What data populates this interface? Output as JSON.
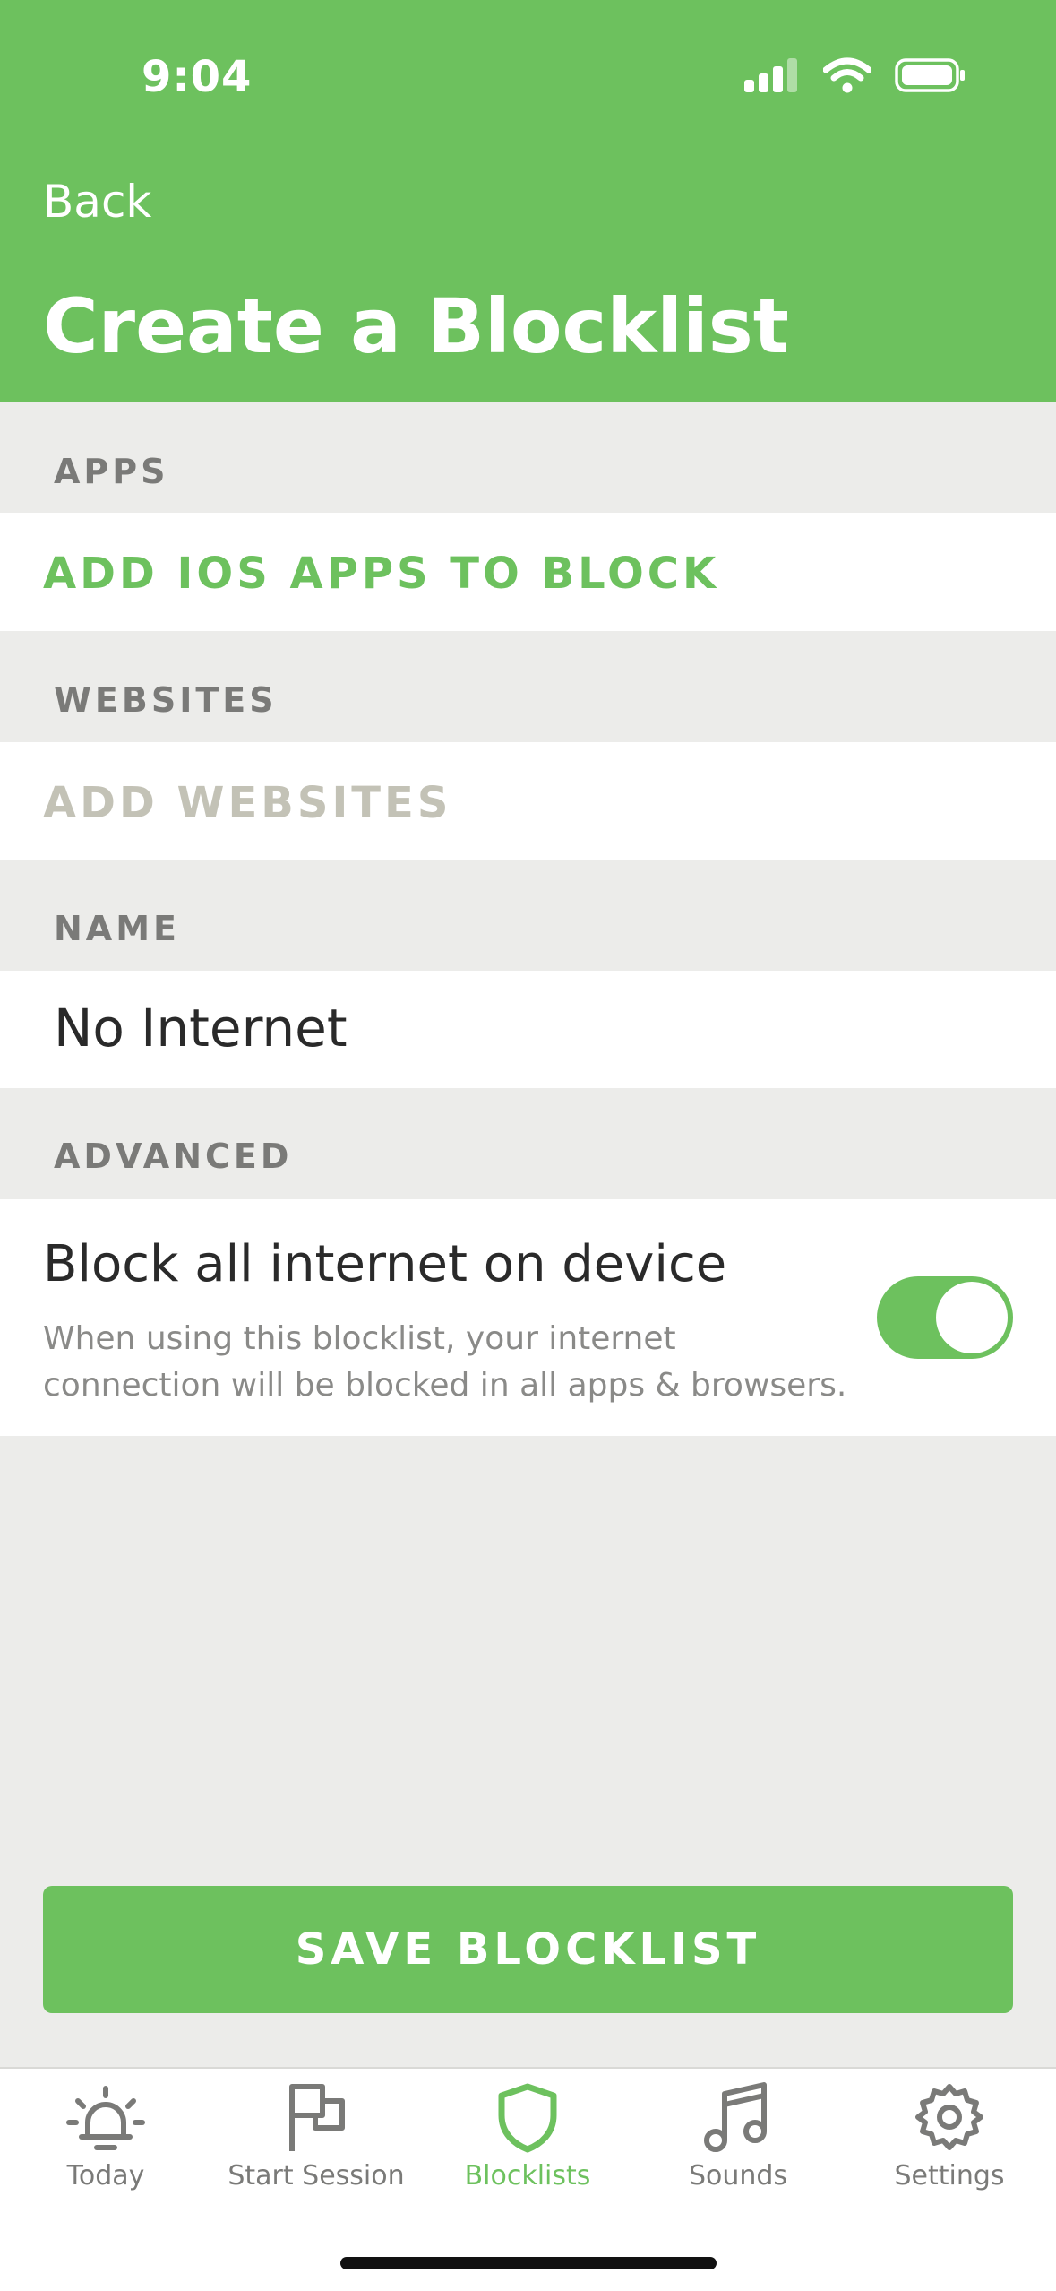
{
  "status_bar": {
    "time": "9:04"
  },
  "header": {
    "back_label": "Back",
    "title": "Create a Blocklist"
  },
  "sections": {
    "apps": {
      "label": "APPS",
      "action": "ADD IOS APPS TO BLOCK"
    },
    "websites": {
      "label": "WEBSITES",
      "action": "ADD WEBSITES"
    },
    "name": {
      "label": "NAME",
      "value": "No Internet"
    },
    "advanced": {
      "label": "ADVANCED",
      "option_title": "Block all internet on device",
      "option_desc_line1": "When using this blocklist, your internet",
      "option_desc_line2": "connection will be blocked in all apps & browsers.",
      "toggle_on": true
    }
  },
  "save_button": "SAVE BLOCKLIST",
  "tabs": [
    {
      "label": "Today",
      "icon": "alarm-icon",
      "active": false
    },
    {
      "label": "Start Session",
      "icon": "flag-icon",
      "active": false
    },
    {
      "label": "Blocklists",
      "icon": "shield-icon",
      "active": true
    },
    {
      "label": "Sounds",
      "icon": "music-note-icon",
      "active": false
    },
    {
      "label": "Settings",
      "icon": "gear-icon",
      "active": false
    }
  ],
  "colors": {
    "accent": "#6dc15e",
    "disabled_text": "#c3c2b6",
    "background": "#ececea"
  }
}
